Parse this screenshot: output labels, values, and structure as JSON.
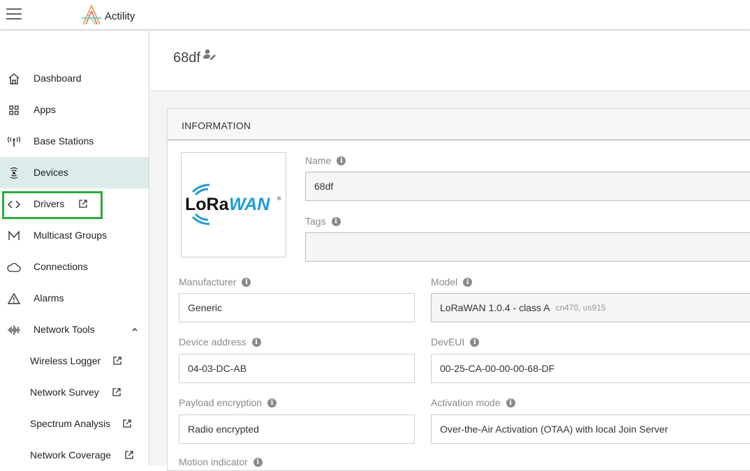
{
  "header": {
    "menu_icon": "hamburger-icon",
    "brand": "Actility",
    "logo_icon": "actility-logo-icon"
  },
  "sidebar": {
    "items": [
      {
        "label": "Dashboard",
        "icon": "home-icon"
      },
      {
        "label": "Apps",
        "icon": "apps-grid-icon"
      },
      {
        "label": "Base Stations",
        "icon": "antenna-icon"
      },
      {
        "label": "Devices",
        "icon": "device-icon",
        "active": true
      },
      {
        "label": "Drivers",
        "icon": "code-icon",
        "external": true
      },
      {
        "label": "Multicast Groups",
        "icon": "multicast-icon"
      },
      {
        "label": "Connections",
        "icon": "cloud-icon"
      },
      {
        "label": "Alarms",
        "icon": "warning-icon"
      },
      {
        "label": "Network Tools",
        "icon": "waveform-icon",
        "expanded": true
      },
      {
        "label": "Wireless Logger",
        "external": true
      },
      {
        "label": "Network Survey",
        "external": true
      },
      {
        "label": "Spectrum Analysis",
        "external": true
      },
      {
        "label": "Network Coverage",
        "external": true
      }
    ]
  },
  "page": {
    "title": "68df",
    "edit_icon": "user-edit-icon"
  },
  "info": {
    "heading": "INFORMATION",
    "logo_text": "LoRaWAN",
    "name_label": "Name",
    "name_value": "68df",
    "tags_label": "Tags",
    "tags_value": "",
    "manufacturer_label": "Manufacturer",
    "manufacturer_value": "Generic",
    "model_label": "Model",
    "model_value": "LoRaWAN 1.0.4 - class A",
    "model_hint": "cn470, us915",
    "device_address_label": "Device address",
    "device_address_value": "04-03-DC-AB",
    "deveui_label": "DevEUI",
    "deveui_value": "00-25-CA-00-00-00-68-DF",
    "payload_label": "Payload encryption",
    "payload_value": "Radio encrypted",
    "activation_label": "Activation mode",
    "activation_value": "Over-the-Air Activation (OTAA) with local Join Server",
    "motion_label": "Motion indicator"
  },
  "colors": {
    "active_bg": "#dcecea",
    "highlight": "#2eaa3c",
    "lorawan_blue": "#1e9ad6"
  }
}
